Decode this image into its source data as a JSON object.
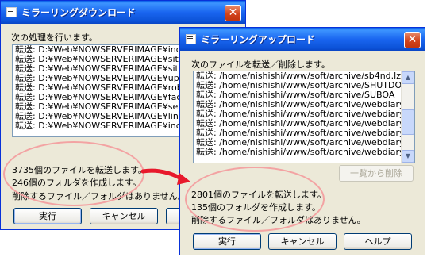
{
  "download_window": {
    "title": "ミラーリングダウンロード",
    "close_label": "✕",
    "instruction": "次の処理を行います。",
    "list_items": [
      "転送: D:¥Web¥NOWSERVERIMAGE¥inde",
      "転送: D:¥Web¥NOWSERVERIMAGE¥site",
      "転送: D:¥Web¥NOWSERVERIMAGE¥site",
      "転送: D:¥Web¥NOWSERVERIMAGE¥upd",
      "転送: D:¥Web¥NOWSERVERIMAGE¥robo",
      "転送: D:¥Web¥NOWSERVERIMAGE¥fact",
      "転送: D:¥Web¥NOWSERVERIMAGE¥sen",
      "転送: D:¥Web¥NOWSERVERIMAGE¥link",
      "転送: D:¥Web¥NOWSERVERIMAGE¥inde"
    ],
    "partial_button_label": "一",
    "summary_files": "3735個のファイルを転送します。",
    "summary_folders": "246個のフォルダを作成します。",
    "summary_delete": "削除するファイル／フォルダはありません。",
    "execute_label": "実行",
    "cancel_label": "キャンセル"
  },
  "upload_window": {
    "title": "ミラーリングアップロード",
    "close_label": "✕",
    "instruction": "次のファイルを転送／削除します。",
    "list_items": [
      "転送: /home/nishishi/www/soft/archive/sb4nd.lz",
      "転送: /home/nishishi/www/soft/archive/SHUTDO",
      "転送: /home/nishishi/www/soft/archive/SUBOA",
      "転送: /home/nishishi/www/soft/archive/webdiary",
      "転送: /home/nishishi/www/soft/archive/webdiary",
      "転送: /home/nishishi/www/soft/archive/webdiary",
      "転送: /home/nishishi/www/soft/archive/webdiary",
      "転送: /home/nishishi/www/soft/archive/webdiary",
      "転送: /home/nishishi/www/soft/archive/webdiary"
    ],
    "remove_from_list_label": "一覧から削除",
    "summary_files": "2801個のファイルを転送します。",
    "summary_folders": "135個のフォルダを作成します。",
    "summary_delete": "削除するファイル／フォルダはありません。",
    "execute_label": "実行",
    "cancel_label": "キャンセル",
    "help_label": "ヘルプ",
    "scroll_up": "▲",
    "scroll_down": "▼"
  },
  "colors": {
    "titlebar": "#0a5fe8",
    "window_face": "#ece9d8",
    "close_button": "#d2431b",
    "annotation": "#f3a3a3",
    "arrow": "#e8192c"
  }
}
